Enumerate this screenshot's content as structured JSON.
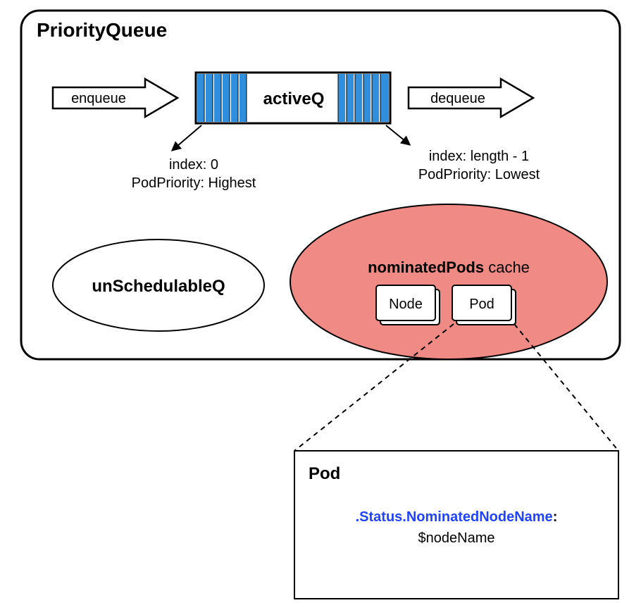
{
  "container": {
    "title": "PriorityQueue"
  },
  "activeQ": {
    "label": "activeQ",
    "enqueue": "enqueue",
    "dequeue": "dequeue",
    "left_annotation": {
      "line1": "index: 0",
      "line2": "PodPriority: Highest"
    },
    "right_annotation": {
      "line1": "index: length - 1",
      "line2": "PodPriority: Lowest"
    }
  },
  "unschedulable": {
    "label": "unSchedulableQ"
  },
  "nominated": {
    "label_bold": "nominatedPods",
    "label_suffix": " cache",
    "card1": "Node",
    "card2": "Pod"
  },
  "detail": {
    "title": "Pod",
    "field": ".Status.NominatedNodeName",
    "sep": ":",
    "value": "$nodeName"
  }
}
